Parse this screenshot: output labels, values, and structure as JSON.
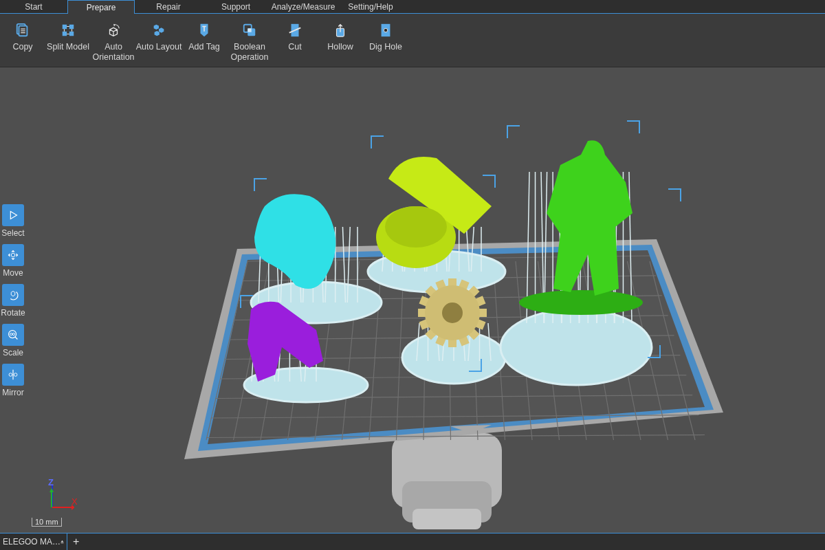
{
  "tabs": [
    {
      "label": "Start",
      "selected": false
    },
    {
      "label": "Prepare",
      "selected": true
    },
    {
      "label": "Repair",
      "selected": false
    },
    {
      "label": "Support",
      "selected": false
    },
    {
      "label": "Analyze/Measure",
      "selected": false
    },
    {
      "label": "Setting/Help",
      "selected": false
    }
  ],
  "toolbar": [
    {
      "label": "Copy",
      "kind": "copy"
    },
    {
      "label": "Split Model",
      "kind": "split"
    },
    {
      "label": "Auto Orientation",
      "kind": "orient"
    },
    {
      "label": "Auto Layout",
      "kind": "layout"
    },
    {
      "label": "Add Tag",
      "kind": "tag"
    },
    {
      "label": "Boolean Operation",
      "kind": "boolean"
    },
    {
      "label": "Cut",
      "kind": "cut"
    },
    {
      "label": "Hollow",
      "kind": "hollow"
    },
    {
      "label": "Dig Hole",
      "kind": "hole"
    }
  ],
  "side_tools": [
    {
      "label": "Select",
      "kind": "select"
    },
    {
      "label": "Move",
      "kind": "move"
    },
    {
      "label": "Rotate",
      "kind": "rotate"
    },
    {
      "label": "Scale",
      "kind": "scale"
    },
    {
      "label": "Mirror",
      "kind": "mirror"
    }
  ],
  "axes": {
    "z": "Z",
    "x": "X"
  },
  "scale_bar": "10 mm",
  "file_tabs": [
    {
      "label": "ELEGOO MA…"
    }
  ],
  "new_tab": "+"
}
